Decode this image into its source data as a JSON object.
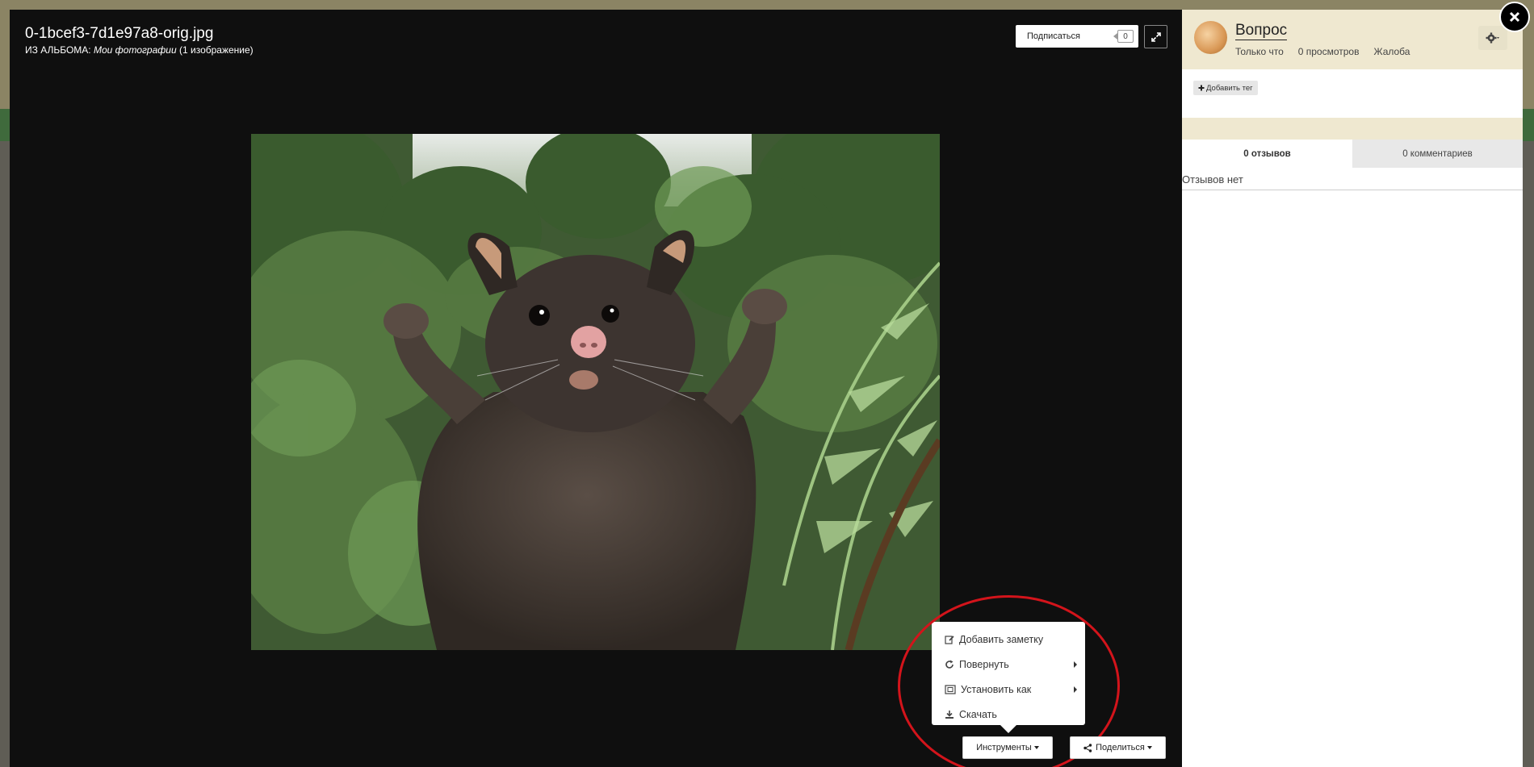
{
  "lightbox": {
    "title": "0-1bcef3-7d1e97a8-orig.jpg",
    "album_prefix": "ИЗ АЛЬБОМА: ",
    "album_name": "Мои фотографии",
    "album_count": " (1 изображение)",
    "subscribe_label": "Подписаться",
    "subscribe_count": "0",
    "expand_icon": "expand-icon"
  },
  "tools_menu": {
    "items": [
      {
        "label": "Добавить заметку",
        "icon": "edit-icon",
        "submenu": false
      },
      {
        "label": "Повернуть",
        "icon": "rotate-icon",
        "submenu": true
      },
      {
        "label": "Установить как",
        "icon": "crop-icon",
        "submenu": true
      },
      {
        "label": "Скачать",
        "icon": "download-icon",
        "submenu": false
      }
    ],
    "tools_label": "Инструменты",
    "share_label": "Поделиться"
  },
  "panel": {
    "author": "Вопрос",
    "time": "Только что",
    "views": "0 просмотров",
    "report": "Жалоба",
    "add_tag": "Добавить тег",
    "tabs": [
      {
        "label": "0 отзывов",
        "active": true
      },
      {
        "label": "0 комментариев",
        "active": false
      }
    ],
    "empty_text": "Отзывов нет"
  },
  "colors": {
    "lightbox_bg": "#0f0f0f",
    "panel_header": "#efe8d0",
    "highlight_circle": "#d3141b"
  }
}
